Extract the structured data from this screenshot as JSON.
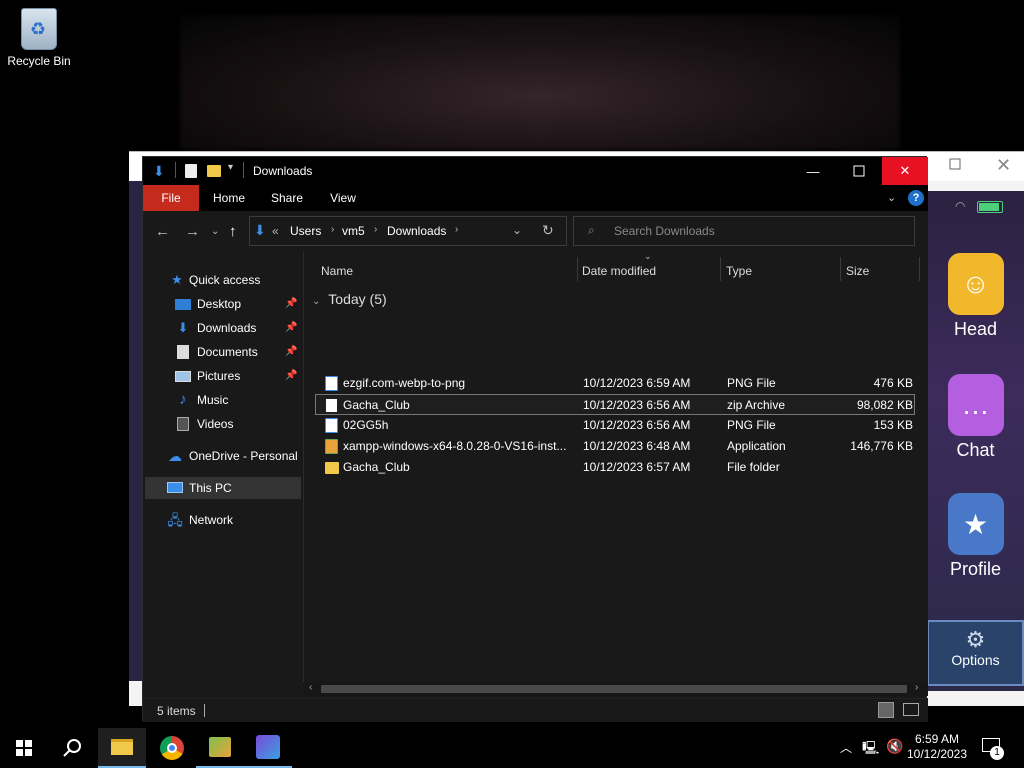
{
  "desktop": {
    "recycle_bin_label": "Recycle Bin",
    "game": {
      "buttons": [
        {
          "label": "Head",
          "icon": "head-icon",
          "color": "#f2b82b"
        },
        {
          "label": "Chat",
          "icon": "chat-icon",
          "color": "#b45ee0"
        },
        {
          "label": "Profile",
          "icon": "profile-icon",
          "color": "#4a78c8"
        }
      ],
      "options_label": "Options"
    }
  },
  "explorer": {
    "title": "Downloads",
    "ribbon_tabs": [
      "File",
      "Home",
      "Share",
      "View"
    ],
    "breadcrumb": {
      "prefix": "«",
      "parts": [
        "Users",
        "vm5",
        "Downloads"
      ]
    },
    "search_placeholder": "Search Downloads",
    "nav": {
      "quick_access": "Quick access",
      "items": [
        {
          "label": "Desktop",
          "icon": "desktop-icon",
          "pinned": true
        },
        {
          "label": "Downloads",
          "icon": "downloads-icon",
          "pinned": true
        },
        {
          "label": "Documents",
          "icon": "documents-icon",
          "pinned": true
        },
        {
          "label": "Pictures",
          "icon": "pictures-icon",
          "pinned": true
        },
        {
          "label": "Music",
          "icon": "music-icon",
          "pinned": false
        },
        {
          "label": "Videos",
          "icon": "videos-icon",
          "pinned": false
        }
      ],
      "onedrive": "OneDrive - Personal",
      "this_pc": "This PC",
      "network": "Network"
    },
    "columns": {
      "name": "Name",
      "date_modified": "Date modified",
      "type": "Type",
      "size": "Size"
    },
    "group_label": "Today (5)",
    "files": [
      {
        "name": "ezgif.com-webp-to-png",
        "date": "10/12/2023 6:59 AM",
        "type": "PNG File",
        "size": "476 KB",
        "icon": "png-file-icon"
      },
      {
        "name": "Gacha_Club",
        "date": "10/12/2023 6:56 AM",
        "type": "zip Archive",
        "size": "98,082 KB",
        "icon": "zip-file-icon"
      },
      {
        "name": "02GG5h",
        "date": "10/12/2023 6:56 AM",
        "type": "PNG File",
        "size": "153 KB",
        "icon": "png-file-icon"
      },
      {
        "name": "xampp-windows-x64-8.0.28-0-VS16-inst...",
        "date": "10/12/2023 6:48 AM",
        "type": "Application",
        "size": "146,776 KB",
        "icon": "application-icon"
      },
      {
        "name": "Gacha_Club",
        "date": "10/12/2023 6:57 AM",
        "type": "File folder",
        "size": "",
        "icon": "folder-icon"
      }
    ],
    "status_items": "5 items",
    "colors": {
      "accent_file_tab": "#c42b1c",
      "close_button": "#e81123",
      "selected_bg": "#333333"
    }
  },
  "taskbar": {
    "time": "6:59 AM",
    "date": "10/12/2023",
    "notification_count": "1",
    "apps": [
      "start-icon",
      "search-icon",
      "file-explorer-icon",
      "chrome-icon",
      "installer-icon",
      "gacha-app-icon"
    ]
  }
}
